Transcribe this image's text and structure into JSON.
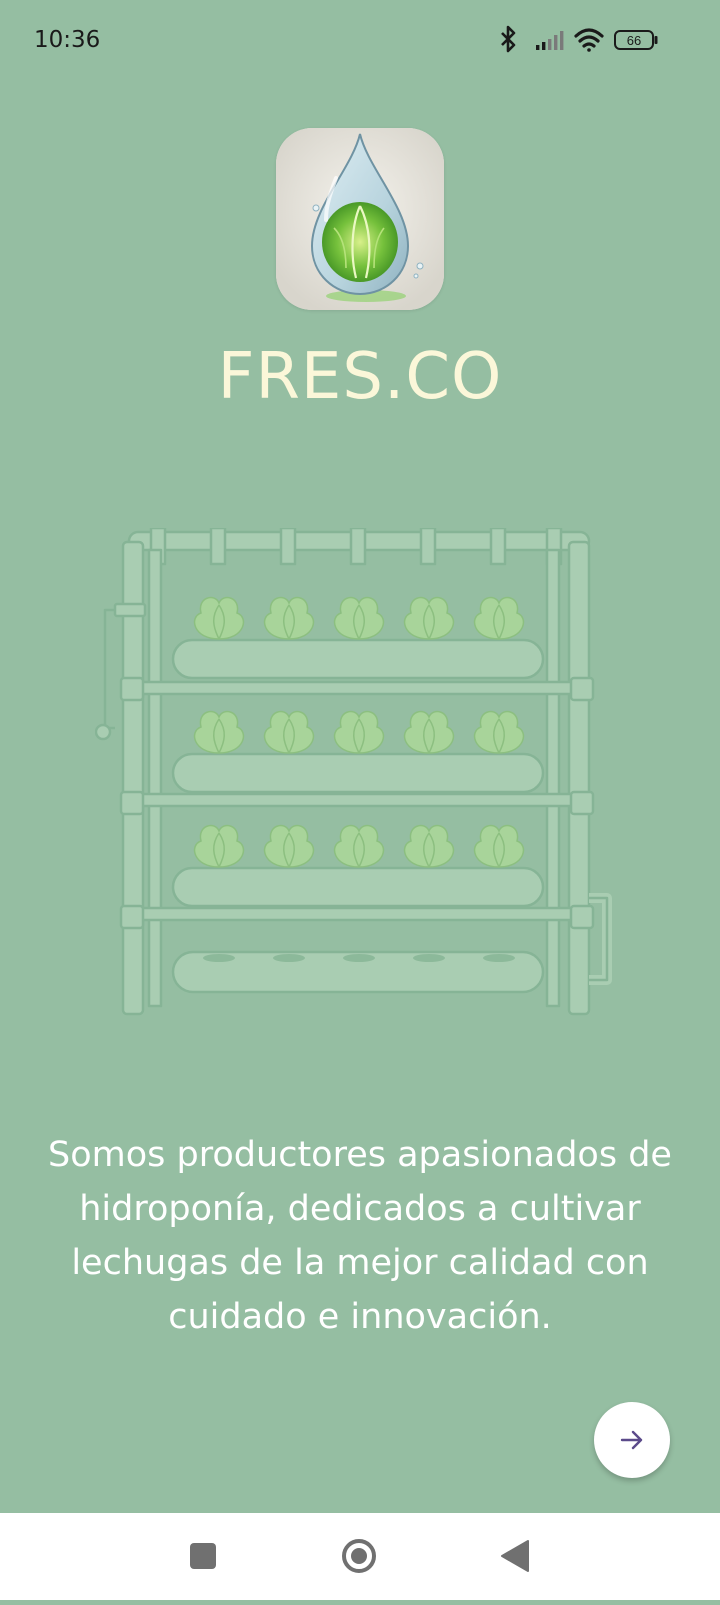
{
  "status_bar": {
    "time": "10:36",
    "battery": "66",
    "icons": [
      "bluetooth-icon",
      "signal-icon",
      "wifi-icon",
      "battery-icon"
    ]
  },
  "app": {
    "name": "FRES.CO",
    "logo": "lettuce-water-drop-logo"
  },
  "hero": {
    "illustration": "hydroponic-rack-with-lettuce"
  },
  "description": "Somos productores apasionados de hidroponía, dedicados a cultivar lechugas de la mejor calidad con cuidado e innovación.",
  "next_button": {
    "icon": "arrow-right-icon"
  },
  "nav_bar": {
    "buttons": [
      "recents-square-icon",
      "home-circle-icon",
      "back-triangle-icon"
    ]
  },
  "colors": {
    "background": "#95bea2",
    "title": "#fbf7d9",
    "text": "#ffffff",
    "accent": "#5b4a8a"
  }
}
